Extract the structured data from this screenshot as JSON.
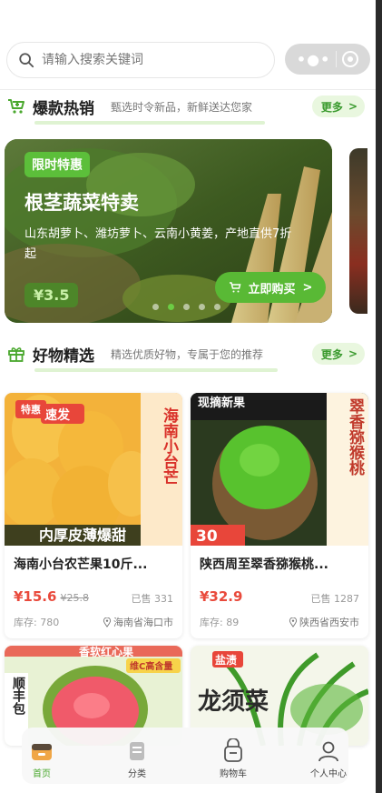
{
  "search": {
    "placeholder": "请输入搜索关键词"
  },
  "hot_section": {
    "title": "爆款热销",
    "subtitle": "甄选时令新品，新鲜送达您家",
    "more_label": "更多"
  },
  "banner": {
    "tag": "限时特惠",
    "title": "根茎蔬菜特卖",
    "description": "山东胡萝卜、潍坊萝卜、云南小黄姜，产地直供7折起",
    "price": "¥3.5",
    "buy_label": "立即购买",
    "slide_count": 5,
    "active_slide": 2
  },
  "picks_section": {
    "title": "好物精选",
    "subtitle": "精选优质好物，专属于您的推荐",
    "more_label": "更多"
  },
  "products": [
    {
      "badge": "特惠",
      "name": "海南小台农芒果10斤...",
      "price": "¥15.6",
      "old_price": "¥25.8",
      "sold": "已售 331",
      "stock": "库存: 780",
      "location": "海南省海口市"
    },
    {
      "name": "陕西周至翠香猕猴桃...",
      "price": "¥32.9",
      "sold": "已售 1287",
      "stock": "库存: 89",
      "location": "陕西省西安市"
    },
    {
      "name": "",
      "price": ""
    },
    {
      "name": "",
      "price": ""
    }
  ],
  "image_text": {
    "mango_side": "海南小台芒",
    "mango_top": "速发",
    "mango_bottom": "内厚皮薄爆甜",
    "kiwi_top": "现摘新果",
    "kiwi_side": "翠香猕猴桃",
    "kiwi_bottom": "30",
    "guava_top": "香软红心果",
    "guava_sub": "维C高含量",
    "guava_side": "顺丰包",
    "veg_title": "龙须菜",
    "veg_tag": "盐渍"
  },
  "tabbar": [
    {
      "label": "首页",
      "icon": "home-icon",
      "active": true
    },
    {
      "label": "分类",
      "icon": "category-icon",
      "active": false
    },
    {
      "label": "购物车",
      "icon": "cart-icon",
      "active": false
    },
    {
      "label": "个人中心",
      "icon": "user-icon",
      "active": false
    }
  ],
  "colors": {
    "accent": "#59b935",
    "price": "#e94a3c",
    "more_bg": "#e9f7df"
  }
}
